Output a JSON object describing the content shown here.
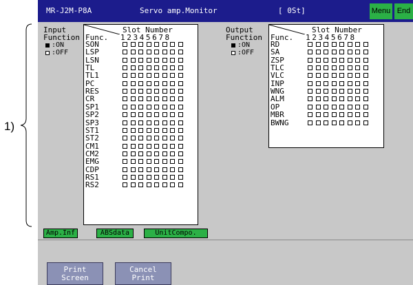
{
  "callout": {
    "label": "1)"
  },
  "titlebar": {
    "model": "MR-J2M-P8A",
    "title": "Servo amp.Monitor",
    "station": "[ 0St]",
    "menu_label": "Menu",
    "end_label": "End"
  },
  "input": {
    "label_line1": "Input",
    "label_line2": "Function",
    "legend_on": ":ON",
    "legend_off": ":OFF",
    "header_slot": "Slot Number",
    "header_func": "Func.",
    "header_nums": "12345678",
    "rows": [
      "SON",
      "LSP",
      "LSN",
      "TL",
      "TL1",
      "PC",
      "RES",
      "CR",
      "SP1",
      "SP2",
      "SP3",
      "ST1",
      "ST2",
      "CM1",
      "CM2",
      "EMG",
      "CDP",
      "RS1",
      "RS2"
    ]
  },
  "output": {
    "label_line1": "Output",
    "label_line2": "Function",
    "legend_on": ":ON",
    "legend_off": ":OFF",
    "header_slot": "Slot Number",
    "header_func": "Func.",
    "header_nums": "12345678",
    "rows": [
      "RD",
      "SA",
      "ZSP",
      "TLC",
      "VLC",
      "INP",
      "WNG",
      "ALM",
      "OP",
      "MBR",
      "BWNG"
    ]
  },
  "status_buttons": {
    "amp_inf": "Amp.Inf",
    "absdata": "ABSdata",
    "unitcompo": "UnitCompo."
  },
  "bottom_buttons": {
    "print_screen": "Print\nScreen",
    "cancel_print": "Cancel\nPrint"
  },
  "colors": {
    "titlebar": "#1c1c8c",
    "screen_bg": "#c8c8c8",
    "green_button": "#2bb046",
    "gray_button": "#8b91b5"
  }
}
